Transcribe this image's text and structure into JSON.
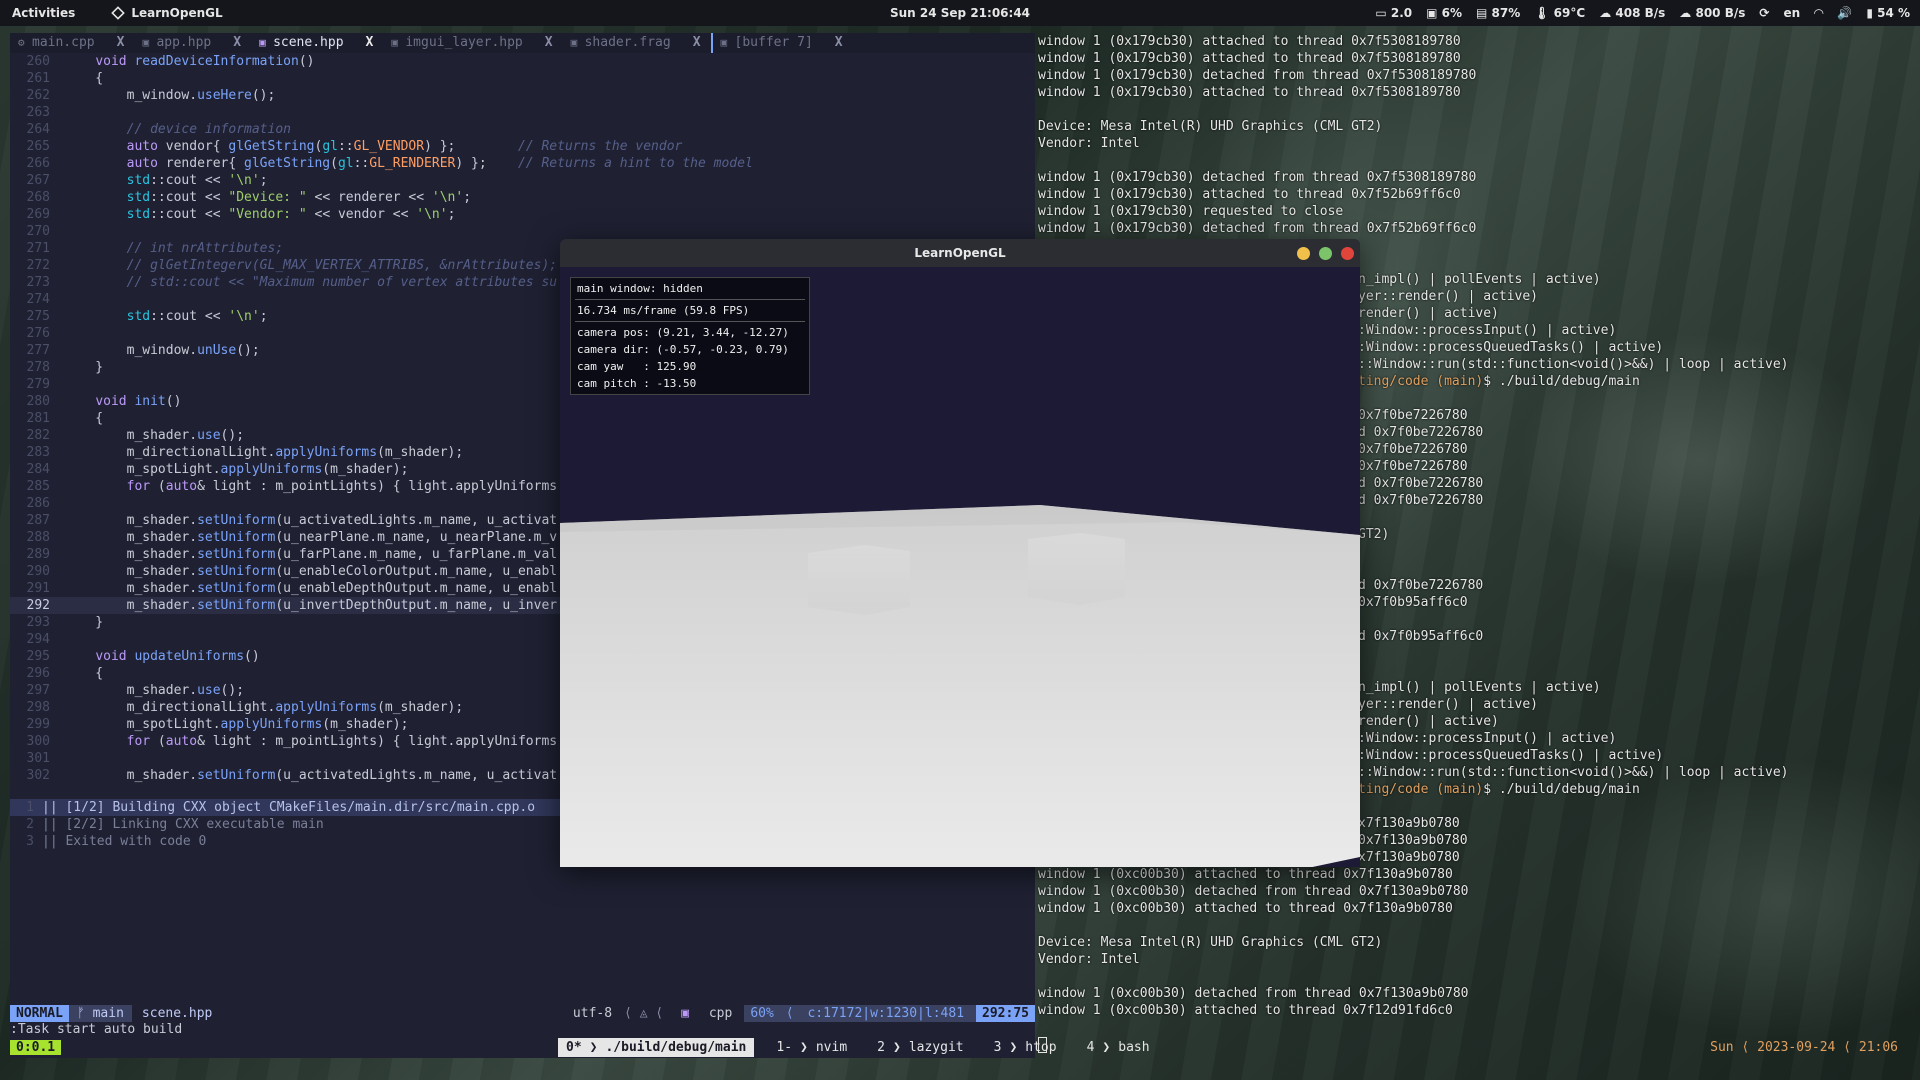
{
  "topbar": {
    "activities": "Activities",
    "app_name": "LearnOpenGL",
    "clock": "Sun 24 Sep  21:06:44",
    "tray": [
      "2.0",
      "6%",
      "87%",
      "69°C",
      "408 B/s",
      "800 B/s",
      "en",
      "54 %"
    ]
  },
  "editor": {
    "tabs": [
      {
        "label": "main.cpp",
        "close": "X"
      },
      {
        "label": "app.hpp",
        "close": "X"
      },
      {
        "label": "scene.hpp",
        "close": "X",
        "active": true
      },
      {
        "label": "imgui_layer.hpp",
        "close": "X"
      },
      {
        "label": "shader.frag",
        "close": "X"
      },
      {
        "label": "[buffer 7]",
        "close": "X"
      }
    ],
    "lines": [
      {
        "n": "260",
        "t": "    void readDeviceInformation()"
      },
      {
        "n": "261",
        "t": "    {"
      },
      {
        "n": "262",
        "t": "        m_window.useHere();"
      },
      {
        "n": "263",
        "t": ""
      },
      {
        "n": "264",
        "t": "        // device information"
      },
      {
        "n": "265",
        "t": "        auto vendor{ glGetString(gl::GL_VENDOR) };        // Returns the vendor"
      },
      {
        "n": "266",
        "t": "        auto renderer{ glGetString(gl::GL_RENDERER) };    // Returns a hint to the model"
      },
      {
        "n": "267",
        "t": "        std::cout << '\\n';"
      },
      {
        "n": "268",
        "t": "        std::cout << \"Device: \" << renderer << '\\n';"
      },
      {
        "n": "269",
        "t": "        std::cout << \"Vendor: \" << vendor << '\\n';"
      },
      {
        "n": "270",
        "t": ""
      },
      {
        "n": "271",
        "t": "        // int nrAttributes;"
      },
      {
        "n": "272",
        "t": "        // glGetIntegerv(GL_MAX_VERTEX_ATTRIBS, &nrAttributes);"
      },
      {
        "n": "273",
        "t": "        // std::cout << \"Maximum number of vertex attributes su"
      },
      {
        "n": "274",
        "t": ""
      },
      {
        "n": "275",
        "t": "        std::cout << '\\n';"
      },
      {
        "n": "276",
        "t": ""
      },
      {
        "n": "277",
        "t": "        m_window.unUse();"
      },
      {
        "n": "278",
        "t": "    }"
      },
      {
        "n": "279",
        "t": ""
      },
      {
        "n": "280",
        "t": "    void init()"
      },
      {
        "n": "281",
        "t": "    {"
      },
      {
        "n": "282",
        "t": "        m_shader.use();"
      },
      {
        "n": "283",
        "t": "        m_directionalLight.applyUniforms(m_shader);"
      },
      {
        "n": "284",
        "t": "        m_spotLight.applyUniforms(m_shader);"
      },
      {
        "n": "285",
        "t": "        for (auto& light : m_pointLights) { light.applyUniforms"
      },
      {
        "n": "286",
        "t": ""
      },
      {
        "n": "287",
        "t": "        m_shader.setUniform(u_activatedLights.m_name, u_activat"
      },
      {
        "n": "288",
        "t": "        m_shader.setUniform(u_nearPlane.m_name, u_nearPlane.m_v"
      },
      {
        "n": "289",
        "t": "        m_shader.setUniform(u_farPlane.m_name, u_farPlane.m_val"
      },
      {
        "n": "290",
        "t": "        m_shader.setUniform(u_enableColorOutput.m_name, u_enabl"
      },
      {
        "n": "291",
        "t": "        m_shader.setUniform(u_enableDepthOutput.m_name, u_enabl"
      },
      {
        "n": "292",
        "t": "        m_shader.setUniform(u_invertDepthOutput.m_name, u_inver",
        "current": true
      },
      {
        "n": "293",
        "t": "    }"
      },
      {
        "n": "294",
        "t": ""
      },
      {
        "n": "295",
        "t": "    void updateUniforms()"
      },
      {
        "n": "296",
        "t": "    {"
      },
      {
        "n": "297",
        "t": "        m_shader.use();"
      },
      {
        "n": "298",
        "t": "        m_directionalLight.applyUniforms(m_shader);"
      },
      {
        "n": "299",
        "t": "        m_spotLight.applyUniforms(m_shader);"
      },
      {
        "n": "300",
        "t": "        for (auto& light : m_pointLights) { light.applyUniforms"
      },
      {
        "n": "301",
        "t": ""
      },
      {
        "n": "302",
        "t": "        m_shader.setUniform(u_activatedLights.m_name, u_activat"
      }
    ],
    "quickfix": [
      {
        "n": "1",
        "t": "|| [1/2] Building CXX object CMakeFiles/main.dir/src/main.cpp.o",
        "selected": true
      },
      {
        "n": "2",
        "t": "|| [2/2] Linking CXX executable main"
      },
      {
        "n": "3",
        "t": "|| Exited with code 0"
      }
    ],
    "status": {
      "mode": "NORMAL",
      "branch": "main",
      "file": "scene.hpp",
      "encoding": "utf-8",
      "filetype": "cpp",
      "percent": "60%",
      "info": "c:17172|w:1230|l:481",
      "position": "292:75"
    },
    "cmdline": ":Task start auto build"
  },
  "terminal": {
    "lines_top": [
      "window 1 (0x179cb30) attached to thread 0x7f5308189780",
      "window 1 (0x179cb30) attached to thread 0x7f5308189780",
      "window 1 (0x179cb30) detached from thread 0x7f5308189780",
      "window 1 (0x179cb30) attached to thread 0x7f5308189780",
      "",
      "Device: Mesa Intel(R) UHD Graphics (CML GT2)",
      "Vendor: Intel",
      "",
      "window 1 (0x179cb30) detached from thread 0x7f5308189780",
      "window 1 (0x179cb30) attached to thread 0x7f52b69ff6c0",
      "window 1 (0x179cb30) requested to close",
      "window 1 (0x179cb30) detached from thread 0x7f52b69ff6c0"
    ],
    "lines_mid": [
      {
        "row": 14,
        "t": "n_impl() | pollEvents | active)"
      },
      {
        "row": 15,
        "t": "yer::render() | active)"
      },
      {
        "row": 16,
        "t": "render() | active)"
      },
      {
        "row": 17,
        "t": ":Window::processInput() | active)"
      },
      {
        "row": 18,
        "t": ":Window::processQueuedTasks() | active)"
      },
      {
        "row": 19,
        "t": "::Window::run(std::function<void()>&&) | loop | active)"
      },
      {
        "row": 20,
        "t": "ting/code (main)$ ./build/debug/main",
        "prompt": true
      },
      {
        "row": 22,
        "t": "0x7f0be7226780"
      },
      {
        "row": 23,
        "t": "d 0x7f0be7226780"
      },
      {
        "row": 24,
        "t": "0x7f0be7226780"
      },
      {
        "row": 25,
        "t": "0x7f0be7226780"
      },
      {
        "row": 26,
        "t": "d 0x7f0be7226780"
      },
      {
        "row": 27,
        "t": "d 0x7f0be7226780"
      },
      {
        "row": 29,
        "t": "GT2)"
      },
      {
        "row": 32,
        "t": "d 0x7f0be7226780"
      },
      {
        "row": 33,
        "t": "0x7f0b95aff6c0"
      },
      {
        "row": 35,
        "t": "d 0x7f0b95aff6c0"
      },
      {
        "row": 38,
        "t": "n_impl() | pollEvents | active)"
      },
      {
        "row": 39,
        "t": "yer::render() | active)"
      },
      {
        "row": 40,
        "t": "render() | active)"
      },
      {
        "row": 41,
        "t": ":Window::processInput() | active)"
      },
      {
        "row": 42,
        "t": ":Window::processQueuedTasks() | active)"
      },
      {
        "row": 43,
        "t": "::Window::run(std::function<void()>&&) | loop | active)"
      },
      {
        "row": 44,
        "t": "ting/code (main)$ ./build/debug/main",
        "prompt": true
      },
      {
        "row": 46,
        "t": "x7f130a9b0780"
      },
      {
        "row": 47,
        "t": "0x7f130a9b0780"
      },
      {
        "row": 48,
        "t": "x7f130a9b0780"
      }
    ],
    "lines_bottom": [
      "window 1 (0xc00b30) attached to thread 0x7f130a9b0780",
      "window 1 (0xc00b30) detached from thread 0x7f130a9b0780",
      "window 1 (0xc00b30) attached to thread 0x7f130a9b0780",
      "",
      "Device: Mesa Intel(R) UHD Graphics (CML GT2)",
      "Vendor: Intel",
      "",
      "window 1 (0xc00b30) detached from thread 0x7f130a9b0780",
      "window 1 (0xc00b30) attached to thread 0x7f12d91fd6c0"
    ]
  },
  "glwindow": {
    "title": "LearnOpenGL",
    "overlay": {
      "window": "main window: hidden",
      "frame": "16.734 ms/frame (59.8 FPS)",
      "camera": [
        "camera pos: (9.21, 3.44, -12.27)",
        "camera dir: (-0.57, -0.23, 0.79)",
        "cam yaw   : 125.90",
        "cam pitch : -13.50"
      ]
    }
  },
  "tmux": {
    "session": "0:0.1",
    "windows": [
      {
        "idx": "0*",
        "name": "./build/debug/main",
        "active": true
      },
      {
        "idx": "1-",
        "name": "nvim"
      },
      {
        "idx": "2",
        "name": "lazygit"
      },
      {
        "idx": "3",
        "name": "htop"
      },
      {
        "idx": "4",
        "name": "bash"
      }
    ],
    "right": "Sun ⟨ 2023-09-24 ⟨ 21:06"
  }
}
